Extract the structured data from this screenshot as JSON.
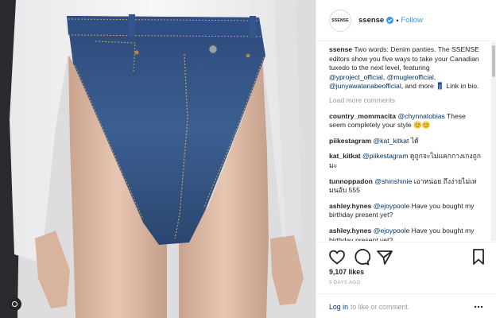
{
  "post": {
    "username": "ssense",
    "avatar_text": "SSENSE",
    "follow_label": "Follow",
    "separator": "•",
    "verified_icon": "verified-badge-icon"
  },
  "caption": {
    "username": "ssense",
    "text_1": "Two words: Denim panties. The SSENSE editors show you five ways to take your Canadian tuxedo to the next level, featuring ",
    "mention_1": "@yproject_official",
    "sep_1": ", ",
    "mention_2": "@muglerofficial",
    "sep_2": ", ",
    "mention_3": "@junyawatanabeofficial",
    "text_2": ", and more ",
    "emoji": "👖",
    "text_3": " Link in bio."
  },
  "load_more_label": "Load more comments",
  "comments": [
    {
      "user": "country_mommacita",
      "mention": "@chynnatobias",
      "text": " These seem completely your style 😊😊"
    },
    {
      "user": "piikestagram",
      "mention": "@kat_kitkat",
      "text": " ได้"
    },
    {
      "user": "kat_kitkat",
      "mention": "@piikestagram",
      "text": " ดูถูกจะไม่แคกกางเกงถูกมะ"
    },
    {
      "user": "tunnoppadon",
      "mention": "@shinshinie",
      "text": " เอาหน่อย ถึงง่ายไม่เหมนอับ 555"
    },
    {
      "user": "ashley.hynes",
      "mention": "@ejoypoole",
      "text": " Have you bought my birthday present yet?"
    },
    {
      "user": "ashley.hynes",
      "mention": "@ejoypoole",
      "text": " Have you bought my birthday present yet?"
    }
  ],
  "actions": {
    "like_icon": "heart-icon",
    "comment_icon": "comment-icon",
    "share_icon": "share-icon",
    "save_icon": "bookmark-icon",
    "likes_text": "9,107 likes",
    "time_ago": "5 DAYS AGO"
  },
  "footer": {
    "login_link": "Log in",
    "login_text": "to like or comment.",
    "more_icon": "more-options-icon"
  },
  "colors": {
    "link": "#3897f0",
    "mention": "#003569",
    "muted": "#999999",
    "border": "#efefef"
  }
}
